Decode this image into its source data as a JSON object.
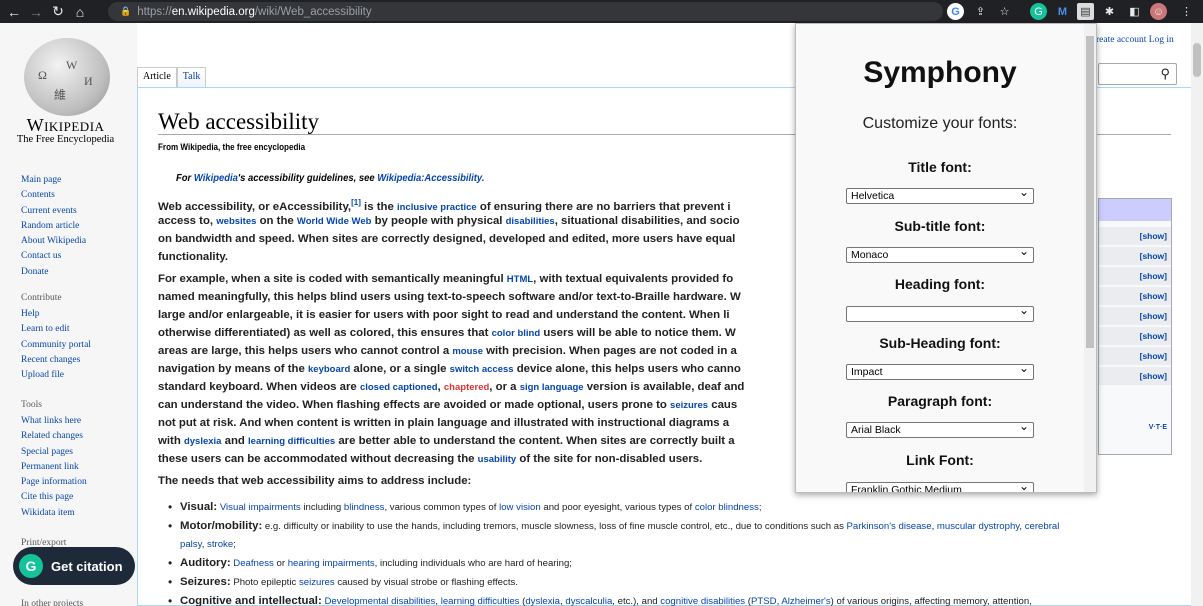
{
  "browser": {
    "url_scheme": "https://",
    "url_host": "en.wikipedia.org",
    "url_path": "/wiki/Web_accessibility"
  },
  "wiki": {
    "wordmark": "Wikipedia",
    "tagline": "The Free Encyclopedia",
    "nav": [
      "Main page",
      "Contents",
      "Current events",
      "Random article",
      "About Wikipedia",
      "Contact us",
      "Donate"
    ],
    "contribute_head": "Contribute",
    "contribute": [
      "Help",
      "Learn to edit",
      "Community portal",
      "Recent changes",
      "Upload file"
    ],
    "tools_head": "Tools",
    "tools": [
      "What links here",
      "Related changes",
      "Special pages",
      "Permanent link",
      "Page information",
      "Cite this page",
      "Wikidata item"
    ],
    "print_head": "Print/export",
    "other_head": "In other projects",
    "tab_article": "Article",
    "tab_talk": "Talk",
    "top_links": "reate account  Log in",
    "title": "Web accessibility",
    "from": "From Wikipedia, the free encyclopedia",
    "hatnote_pre": "For ",
    "hatnote_link1": "Wikipedia",
    "hatnote_mid": "'s accessibility guidelines, see ",
    "hatnote_link2": "Wikipedia:Accessibility.",
    "navbox_show": "[show]",
    "navbox_vte": "V·T·E"
  },
  "citation": {
    "label": "Get citation"
  },
  "panel": {
    "title": "Symphony",
    "subtitle": "Customize your fonts:",
    "fields": [
      {
        "label": "Title font:",
        "value": "Helvetica"
      },
      {
        "label": "Sub-title font:",
        "value": "Monaco"
      },
      {
        "label": "Heading font:",
        "value": ""
      },
      {
        "label": "Sub-Heading font:",
        "value": "Impact"
      },
      {
        "label": "Paragraph font:",
        "value": "Arial Black"
      },
      {
        "label": "Link Font:",
        "value": "Franklin Gothic Medium"
      }
    ]
  }
}
